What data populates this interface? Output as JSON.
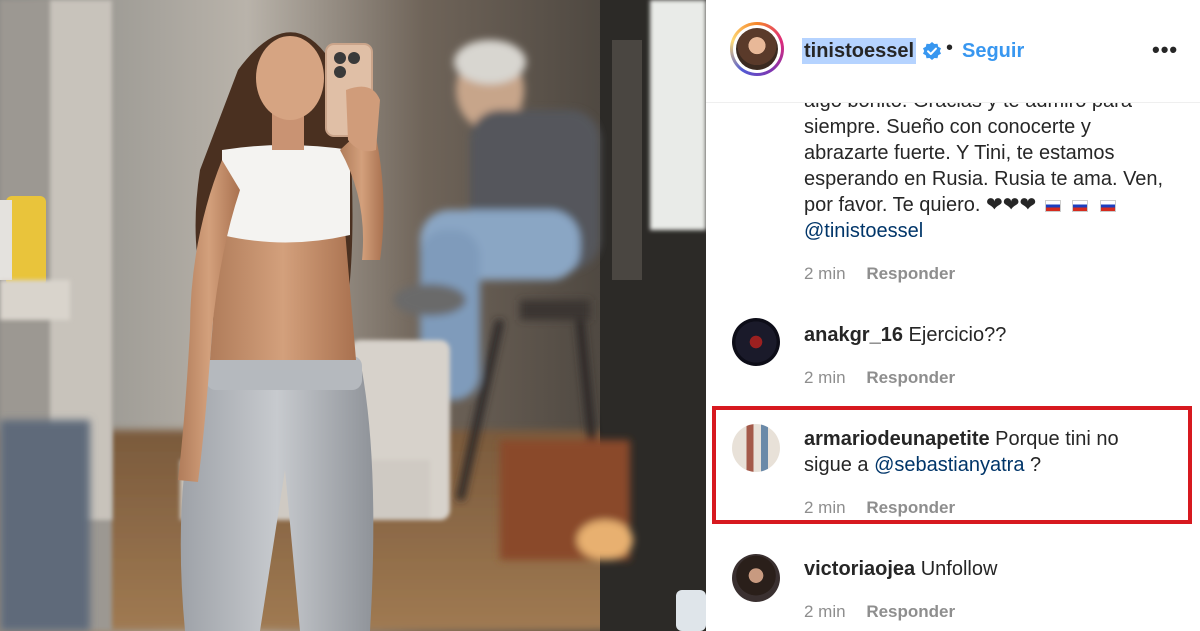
{
  "header": {
    "username": "tinistoessel",
    "verified_icon": "verified-badge-icon",
    "separator": "•",
    "follow_label": "Seguir",
    "more_label": "•••",
    "accent_color": "#3897f0"
  },
  "caption_comment": {
    "lines": [
      "siempre. Sueño con conocerte y",
      "abrazarte fuerte. Y Tini, te estamos",
      "esperando en Rusia. Rusia te ama. Ven,",
      "por favor. Te quiero."
    ],
    "emoji": "❤❤❤",
    "mention": "@tinistoessel",
    "time": "2 min",
    "reply_label": "Responder"
  },
  "comments": [
    {
      "user": "anakgr_16",
      "text": "Ejercicio??",
      "time": "2 min",
      "reply_label": "Responder"
    },
    {
      "user": "armariodeunapetite",
      "text": "Porque tini no",
      "text_line2_prefix": "sigue a",
      "mention": "@sebastianyatra",
      "text_line2_suffix": "?",
      "time": "2 min",
      "reply_label": "Responder",
      "highlighted": true
    },
    {
      "user": "victoriaojea",
      "text": "Unfollow",
      "time": "2 min",
      "reply_label": "Responder"
    }
  ],
  "colors": {
    "highlight_border": "#d7191f",
    "mention": "#003569",
    "meta_text": "#8e8e8e"
  }
}
